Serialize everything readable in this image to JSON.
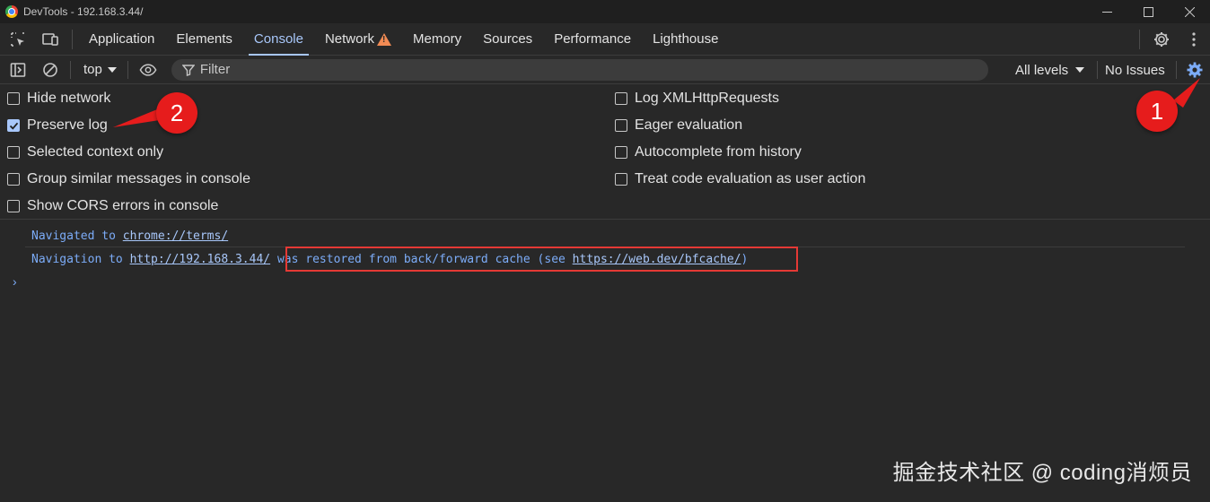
{
  "window": {
    "title": "DevTools - 192.168.3.44/",
    "controls": [
      "minimize-icon",
      "maximize-icon",
      "close-icon"
    ]
  },
  "tabs": [
    {
      "label": "Application",
      "active": false
    },
    {
      "label": "Elements",
      "active": false
    },
    {
      "label": "Console",
      "active": true
    },
    {
      "label": "Network",
      "active": false,
      "warning": true
    },
    {
      "label": "Memory",
      "active": false
    },
    {
      "label": "Sources",
      "active": false
    },
    {
      "label": "Performance",
      "active": false
    },
    {
      "label": "Lighthouse",
      "active": false
    }
  ],
  "toolbar": {
    "context": "top",
    "filter_placeholder": "Filter",
    "levels": "All levels",
    "issues": "No Issues"
  },
  "settings": {
    "left": [
      {
        "label": "Hide network",
        "checked": false
      },
      {
        "label": "Preserve log",
        "checked": true
      },
      {
        "label": "Selected context only",
        "checked": false
      },
      {
        "label": "Group similar messages in console",
        "checked": false
      },
      {
        "label": "Show CORS errors in console",
        "checked": false
      }
    ],
    "right": [
      {
        "label": "Log XMLHttpRequests",
        "checked": false
      },
      {
        "label": "Eager evaluation",
        "checked": false
      },
      {
        "label": "Autocomplete from history",
        "checked": false
      },
      {
        "label": "Treat code evaluation as user action",
        "checked": false
      }
    ]
  },
  "console": {
    "msg1_prefix": "Navigated to ",
    "msg1_link": "chrome://terms/",
    "msg2_prefix": "Navigation to ",
    "msg2_link": "http://192.168.3.44/",
    "msg2_middle": " was restored from back/forward cache (see ",
    "msg2_link2": "https://web.dev/bfcache/",
    "msg2_suffix": ")",
    "prompt": "›"
  },
  "annotations": {
    "badge1": "1",
    "badge2": "2",
    "color": "#e61c1c"
  },
  "watermark": "掘金技术社区 @ coding消烦员",
  "colors": {
    "accent": "#a8c7fa",
    "link": "#7cacf8",
    "warning": "#f28b54",
    "background": "#282828"
  }
}
